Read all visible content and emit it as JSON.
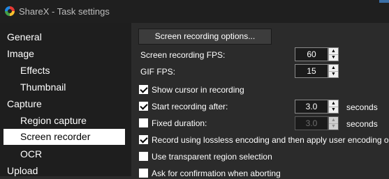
{
  "window": {
    "title": "ShareX - Task settings"
  },
  "sidebar": {
    "items": [
      {
        "label": "General"
      },
      {
        "label": "Image"
      },
      {
        "label": "Effects"
      },
      {
        "label": "Thumbnail"
      },
      {
        "label": "Capture"
      },
      {
        "label": "Region capture"
      },
      {
        "label": "Screen recorder",
        "selected": true
      },
      {
        "label": "OCR"
      },
      {
        "label": "Upload"
      }
    ]
  },
  "main": {
    "options_button": "Screen recording options...",
    "fps": {
      "label": "Screen recording FPS:",
      "value": "60"
    },
    "gif_fps": {
      "label": "GIF FPS:",
      "value": "15"
    },
    "show_cursor": {
      "label": "Show cursor in recording",
      "checked": true
    },
    "start_after": {
      "label": "Start recording after:",
      "checked": true,
      "value": "3.0",
      "unit": "seconds"
    },
    "fixed_duration": {
      "label": "Fixed duration:",
      "checked": false,
      "value": "3.0",
      "unit": "seconds",
      "disabled": true
    },
    "lossless": {
      "label": "Record using lossless encoding and then apply user encoding option",
      "checked": true
    },
    "transparent_region": {
      "label": "Use transparent region selection",
      "checked": false
    },
    "confirm_abort": {
      "label": "Ask for confirmation when aborting",
      "checked": false
    }
  },
  "colors": {
    "window_bg": "#2b2b2b",
    "sidebar_bg": "#1e1e1e",
    "titlebar_bg": "#1f1f1f",
    "selected_bg": "#ffffff",
    "selected_text": "#000000",
    "text": "#ffffff"
  },
  "icons": {
    "app": "sharex-logo-icon",
    "spin_up": "chevron-up-icon",
    "spin_down": "chevron-down-icon",
    "checkmark": "checkmark-icon"
  }
}
